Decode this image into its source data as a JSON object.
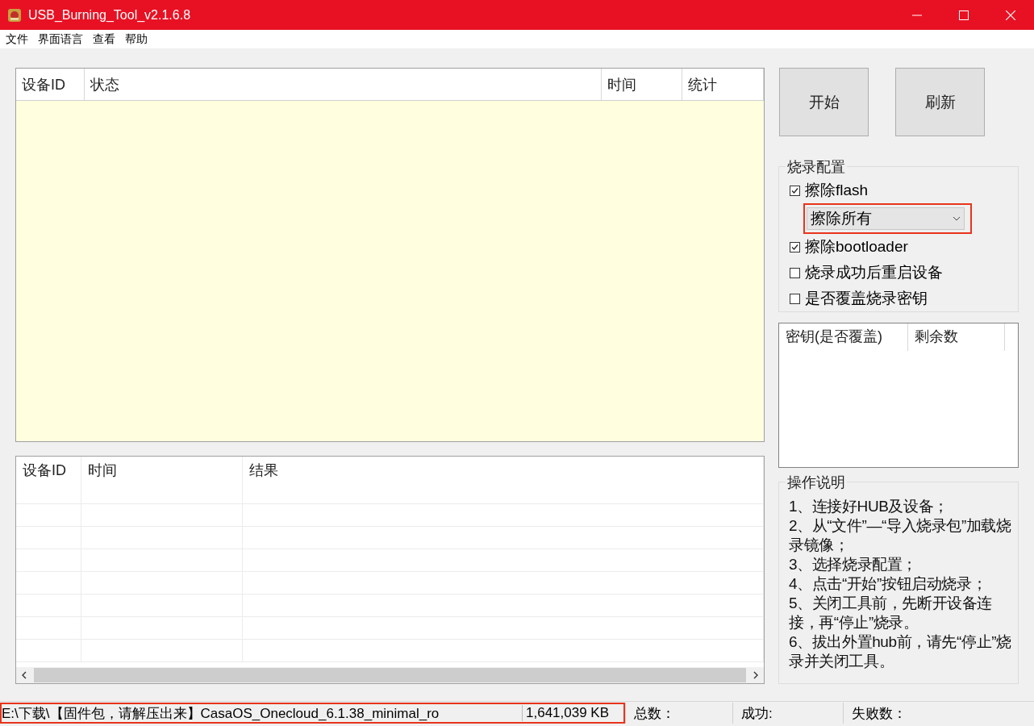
{
  "window": {
    "title": "USB_Burning_Tool_v2.1.6.8"
  },
  "menu": [
    "文件",
    "界面语言",
    "查看",
    "帮助"
  ],
  "device_table": {
    "columns": [
      "设备ID",
      "状态",
      "时间",
      "统计"
    ]
  },
  "log_table": {
    "columns": [
      "设备ID",
      "时间",
      "结果"
    ]
  },
  "buttons": [
    "开始",
    "刷新"
  ],
  "burn_config": {
    "title": "烧录配置",
    "options": [
      {
        "kind": "checkbox",
        "label": "擦除flash",
        "checked": true
      },
      {
        "kind": "dropdown",
        "value": "擦除所有",
        "highlighted": true
      },
      {
        "kind": "checkbox",
        "label": "擦除bootloader",
        "checked": true
      },
      {
        "kind": "checkbox",
        "label": "烧录成功后重启设备",
        "checked": false
      },
      {
        "kind": "checkbox",
        "label": "是否覆盖烧录密钥",
        "checked": false
      }
    ]
  },
  "key_table": {
    "columns": [
      "密钥(是否覆盖)",
      "剩余数"
    ]
  },
  "instructions": {
    "title": "操作说明",
    "steps": [
      "1、连接好HUB及设备；",
      "2、从“文件”—“导入烧录包”加载烧录镜像；",
      "3、选择烧录配置；",
      "4、点击“开始”按钮启动烧录；",
      "5、关闭工具前，先断开设备连接，再“停止”烧录。",
      "6、拔出外置hub前，请先“停止”烧录并关闭工具。"
    ]
  },
  "status_bar": {
    "file_path": "E:\\下载\\【固件包，请解压出来】CasaOS_Onecloud_6.1.38_minimal_ro",
    "file_size": "1,641,039 KB",
    "highlighted": true,
    "total_label": "总数：",
    "success_label": "成功:",
    "fail_label": "失败数："
  }
}
